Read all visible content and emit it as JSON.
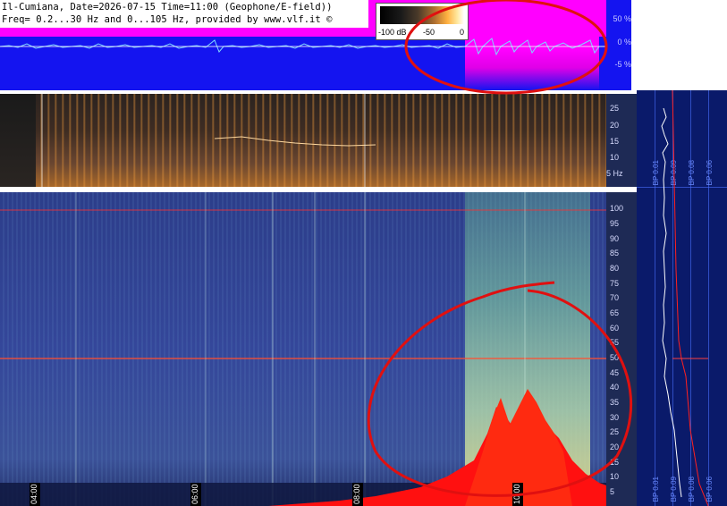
{
  "header": {
    "line1": "Il-Cumiana, Date=2026-07-15 Time=11:00 (Geophone/E-field))",
    "line2": "Freq= 0.2...30 Hz and 0...105 Hz, provided by www.vlf.it ©"
  },
  "colorbar": {
    "labels": [
      "-100 dB",
      "-50",
      "0"
    ]
  },
  "top_scale": {
    "labels": [
      "50 %",
      "0 %",
      "-5 %"
    ]
  },
  "mid_scale": {
    "labels": [
      "25",
      "20",
      "15",
      "10",
      "5 Hz"
    ]
  },
  "bottom_scale": {
    "labels": [
      "100",
      "95",
      "90",
      "85",
      "80",
      "75",
      "70",
      "65",
      "60",
      "55",
      "50",
      "45",
      "40",
      "35",
      "30",
      "25",
      "20",
      "15",
      "10",
      "5"
    ]
  },
  "time_labels": [
    "04:00",
    "06:00",
    "08:00",
    "10:00"
  ],
  "right_graph": {
    "labels": [
      "BP 0.01",
      "BP 0.09",
      "BP 0.08",
      "BP 0.06",
      "BP 0.01",
      "BP 0.09",
      "BP 0.08",
      "BP 0.06"
    ]
  },
  "colors": {
    "top_field": "#1414f0",
    "magenta": "#ff00ff",
    "annotation": "#e01010",
    "axis_bg": "#1e2a55"
  }
}
